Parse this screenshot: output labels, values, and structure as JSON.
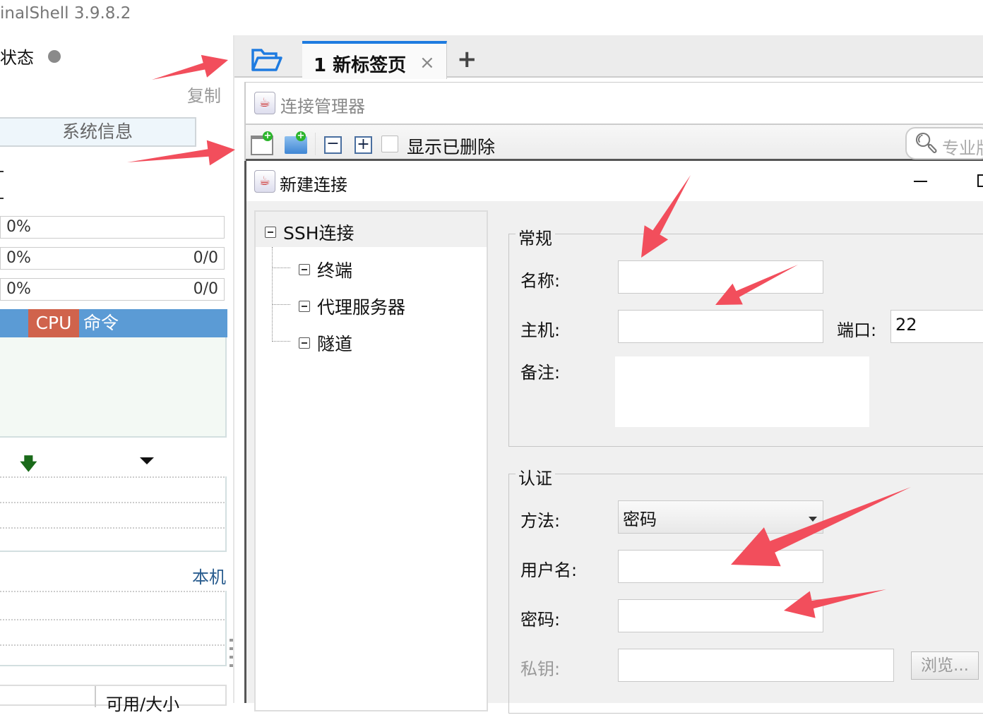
{
  "app": {
    "title": "inalShell 3.9.8.2"
  },
  "left": {
    "status_label": "状态",
    "copy_label": "复制",
    "sysinfo_button": "系统信息",
    "bars": [
      {
        "left": "0%",
        "right": ""
      },
      {
        "left": "0%",
        "right": "0/0"
      },
      {
        "left": "0%",
        "right": "0/0"
      }
    ],
    "tabs": [
      {
        "label": "CPU",
        "active": true
      },
      {
        "label": "命令",
        "active": false
      }
    ],
    "local_label": "本机",
    "table_header": "可用/大小"
  },
  "tabs": {
    "items": [
      {
        "label": "1 新标签页"
      }
    ],
    "close": "×",
    "add": "+"
  },
  "conn_manager": {
    "title": "连接管理器",
    "show_deleted": "显示已删除",
    "search_placeholder": "专业版"
  },
  "dialog": {
    "title": "新建连接",
    "minimize": "—",
    "tree": {
      "root": "SSH连接",
      "children": [
        "终端",
        "代理服务器",
        "隧道"
      ]
    },
    "general": {
      "legend": "常规",
      "name_label": "名称:",
      "name_value": "",
      "host_label": "主机:",
      "host_value": "",
      "port_label": "端口:",
      "port_value": "22",
      "note_label": "备注:",
      "note_value": ""
    },
    "auth": {
      "legend": "认证",
      "method_label": "方法:",
      "method_value": "密码",
      "username_label": "用户名:",
      "username_value": "",
      "password_label": "密码:",
      "password_value": "",
      "key_label": "私钥:",
      "key_value": "",
      "browse_button": "浏览..."
    }
  },
  "colors": {
    "accent": "#5b9bd5",
    "cpu_tab": "#d0634c",
    "tab_indicator": "#1e7be0",
    "annotation_arrow": "#f24e5c",
    "link": "#2a5d8f"
  }
}
